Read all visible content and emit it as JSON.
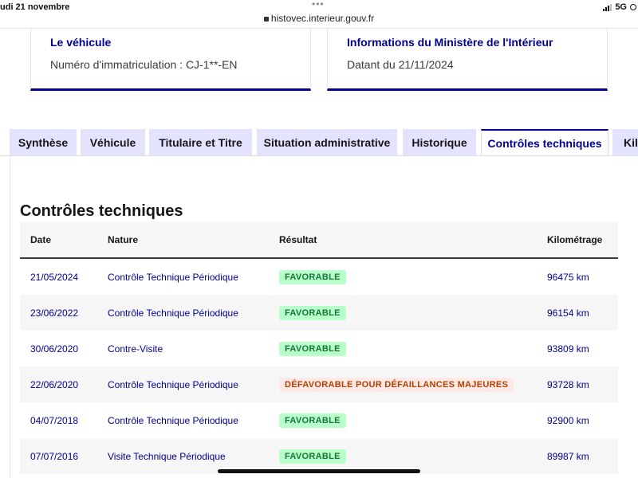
{
  "status_bar": {
    "date": "udi 21 novembre",
    "network": "5G",
    "url": "histovec.interieur.gouv.fr"
  },
  "cards": [
    {
      "title": "Le véhicule",
      "value": "Numéro d'immatriculation : CJ-1**-EN"
    },
    {
      "title": "Informations du Ministère de l'Intérieur",
      "value": "Datant du 21/11/2024"
    }
  ],
  "tabs": [
    {
      "label": "Synthèse",
      "active": false
    },
    {
      "label": "Véhicule",
      "active": false
    },
    {
      "label": "Titulaire et Titre",
      "active": false
    },
    {
      "label": "Situation administrative",
      "active": false
    },
    {
      "label": "Historique",
      "active": false
    },
    {
      "label": "Contrôles techniques",
      "active": true
    },
    {
      "label": "Kil",
      "active": false
    }
  ],
  "section": {
    "title": "Contrôles techniques"
  },
  "table": {
    "headers": {
      "date": "Date",
      "nature": "Nature",
      "result": "Résultat",
      "mileage": "Kilométrage"
    },
    "rows": [
      {
        "date": "21/05/2024",
        "nature": "Contrôle Technique Périodique",
        "result": "FAVORABLE",
        "result_status": "ok",
        "mileage": "96475 km"
      },
      {
        "date": "23/06/2022",
        "nature": "Contrôle Technique Périodique",
        "result": "FAVORABLE",
        "result_status": "ok",
        "mileage": "96154 km"
      },
      {
        "date": "30/06/2020",
        "nature": "Contre-Visite",
        "result": "FAVORABLE",
        "result_status": "ok",
        "mileage": "93809 km"
      },
      {
        "date": "22/06/2020",
        "nature": "Contrôle Technique Périodique",
        "result": "DÉFAVORABLE POUR DÉFAILLANCES MAJEURES",
        "result_status": "ko",
        "mileage": "93728 km"
      },
      {
        "date": "04/07/2018",
        "nature": "Contrôle Technique Périodique",
        "result": "FAVORABLE",
        "result_status": "ok",
        "mileage": "92900 km"
      },
      {
        "date": "07/07/2016",
        "nature": "Visite Technique Périodique",
        "result": "FAVORABLE",
        "result_status": "ok",
        "mileage": "89987 km"
      }
    ]
  },
  "colors": {
    "primary": "#000091",
    "tab_bg": "#e3e3fd",
    "success_bg": "#b8fec9",
    "success_text": "#18753c",
    "error_bg": "#ffe9e6",
    "error_text": "#b34000"
  }
}
